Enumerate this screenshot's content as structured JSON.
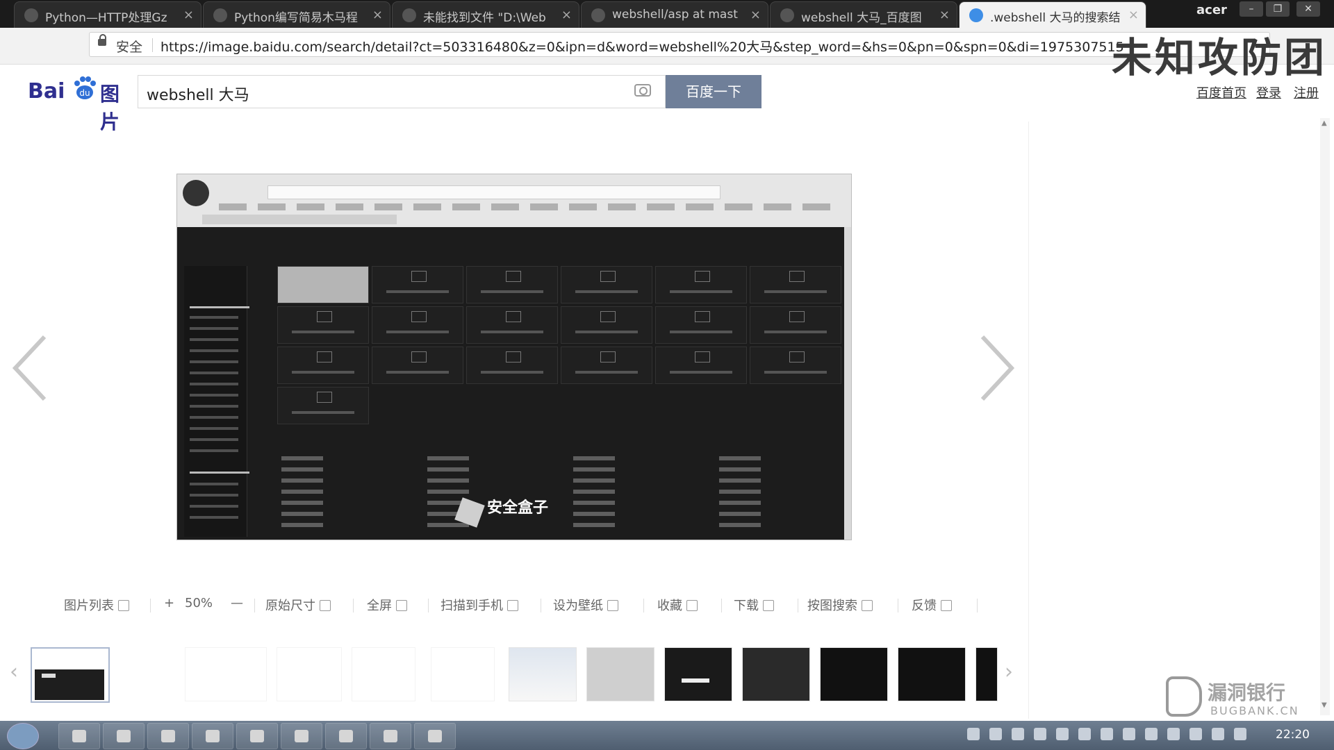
{
  "browser": {
    "tabs": [
      {
        "label": "Python—HTTP处理Gz"
      },
      {
        "label": "Python编写简易木马程"
      },
      {
        "label": "未能找到文件 \"D:\\Web"
      },
      {
        "label": "webshell/asp at mast"
      },
      {
        "label": "webshell 大马_百度图"
      },
      {
        "label": ".webshell 大马的搜索结"
      }
    ],
    "brand": "acer",
    "secure_label": "安全",
    "url": "https://image.baidu.com/search/detail?ct=503316480&z=0&ipn=d&word=webshell%20大马&step_word=&hs=0&pn=0&spn=0&di=1975307515"
  },
  "watermark_top": "未知攻防团",
  "header": {
    "logo_bai": "Bai",
    "logo_du": "du",
    "logo_pic": "图片",
    "search_value": "webshell 大马",
    "search_button": "百度一下",
    "links": [
      "百度首页",
      "登录",
      "注册"
    ]
  },
  "viewer": {
    "overlay_text": "安全盒子"
  },
  "toolbar": {
    "items": [
      "图片列表",
      "+",
      "50%",
      "—",
      "原始尺寸",
      "全屏",
      "扫描到手机",
      "设为壁纸",
      "收藏",
      "下载",
      "按图搜索",
      "反馈"
    ]
  },
  "watermark_logo": {
    "cn": "漏洞银行",
    "en": "BUGBANK.CN"
  },
  "taskbar": {
    "clock": "22:20"
  },
  "colors": {
    "search_button_bg": "#6f7f99",
    "chrome_dark": "#1b1b1b",
    "taskbar": "#5a6a7d"
  }
}
